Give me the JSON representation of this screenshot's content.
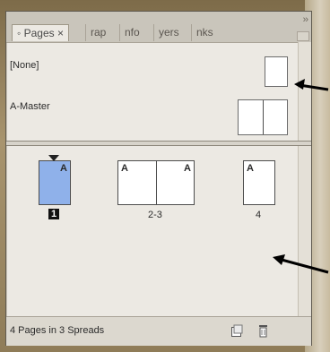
{
  "tabs": [
    {
      "label": "◦ Pages ×"
    },
    {
      "label": "rap"
    },
    {
      "label": "nfo"
    },
    {
      "label": "yers"
    },
    {
      "label": "nks"
    }
  ],
  "flyout_glyph": "››",
  "masters": [
    {
      "label": "[None]",
      "pages": 1
    },
    {
      "label": "A-Master",
      "pages": 2
    }
  ],
  "spreads": [
    {
      "pages": [
        {
          "prefix": "A",
          "selected": true
        }
      ],
      "label": "1",
      "label_selected": true
    },
    {
      "pages": [
        {
          "prefix": "A"
        },
        {
          "prefix": "A"
        }
      ],
      "label": "2-3",
      "label_selected": false
    },
    {
      "pages": [
        {
          "prefix": "A"
        }
      ],
      "label": "4",
      "label_selected": false
    }
  ],
  "status": {
    "text": "4 Pages in 3 Spreads"
  },
  "icons": {
    "new_page": "new-page-icon",
    "delete_page": "delete-page-icon",
    "flyout": "panel-menu-icon"
  },
  "colors": {
    "selected_page": "#8fb1ea",
    "panel_bg": "#ece9e3",
    "arrow": "#000000"
  }
}
